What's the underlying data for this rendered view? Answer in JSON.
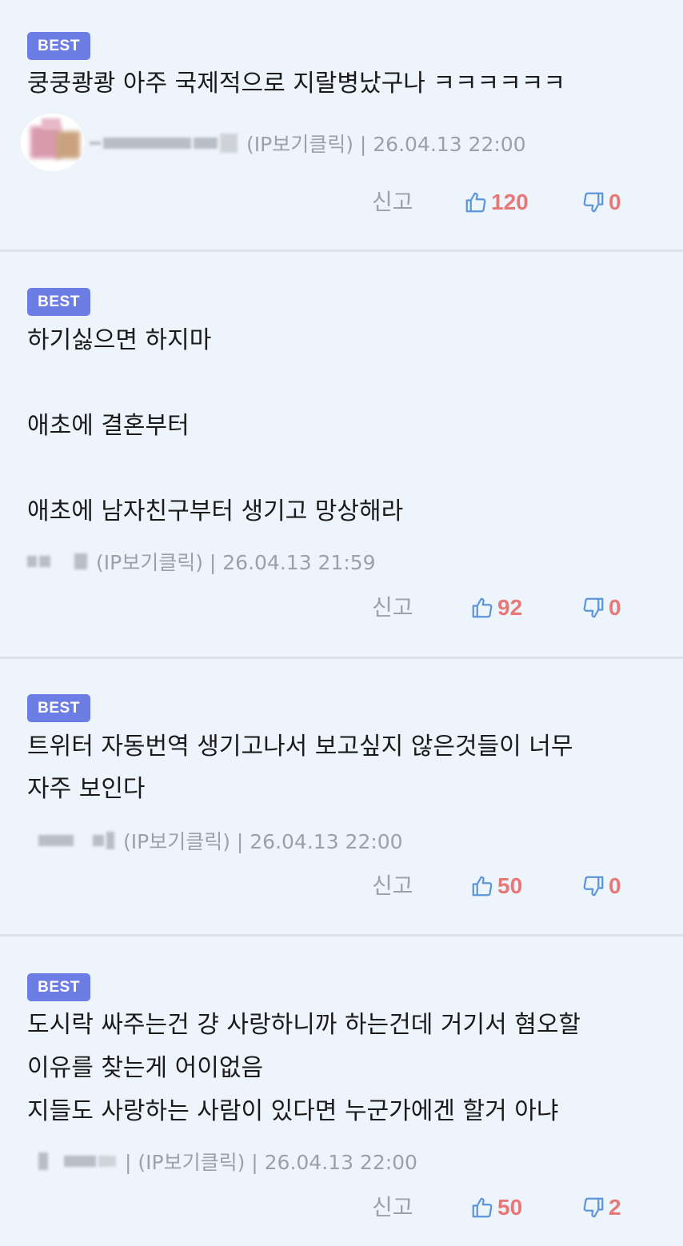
{
  "colors": {
    "badge_bg": "#6c7de6",
    "vote_count": "#e87878",
    "thumb_icon": "#5b95dc",
    "meta_text": "#9aa1a8"
  },
  "comments": [
    {
      "badge": "BEST",
      "lines": [
        "쿵쿵쾅쾅 아주 국제적으로 지랄병났구나 ㅋㅋㅋㅋㅋㅋ"
      ],
      "meta": "(IP보기클릭) | 26.04.13 22:00",
      "report_label": "신고",
      "upvotes": "120",
      "downvotes": "0"
    },
    {
      "badge": "BEST",
      "lines": [
        "하기싫으면 하지마",
        "애초에 결혼부터",
        "애초에 남자친구부터 생기고 망상해라"
      ],
      "meta": "(IP보기클릭) | 26.04.13 21:59",
      "report_label": "신고",
      "upvotes": "92",
      "downvotes": "0"
    },
    {
      "badge": "BEST",
      "lines": [
        "트위터 자동번역 생기고나서 보고싶지 않은것들이 너무",
        "자주 보인다"
      ],
      "meta": "(IP보기클릭) | 26.04.13 22:00",
      "report_label": "신고",
      "upvotes": "50",
      "downvotes": "0"
    },
    {
      "badge": "BEST",
      "lines": [
        "도시락 싸주는건 걍 사랑하니까 하는건데 거기서 혐오할",
        "이유를 찾는게 어이없음",
        "지들도 사랑하는 사람이 있다면 누군가에겐 할거 아냐"
      ],
      "meta": "| (IP보기클릭) | 26.04.13 22:00",
      "report_label": "신고",
      "upvotes": "50",
      "downvotes": "2"
    }
  ]
}
